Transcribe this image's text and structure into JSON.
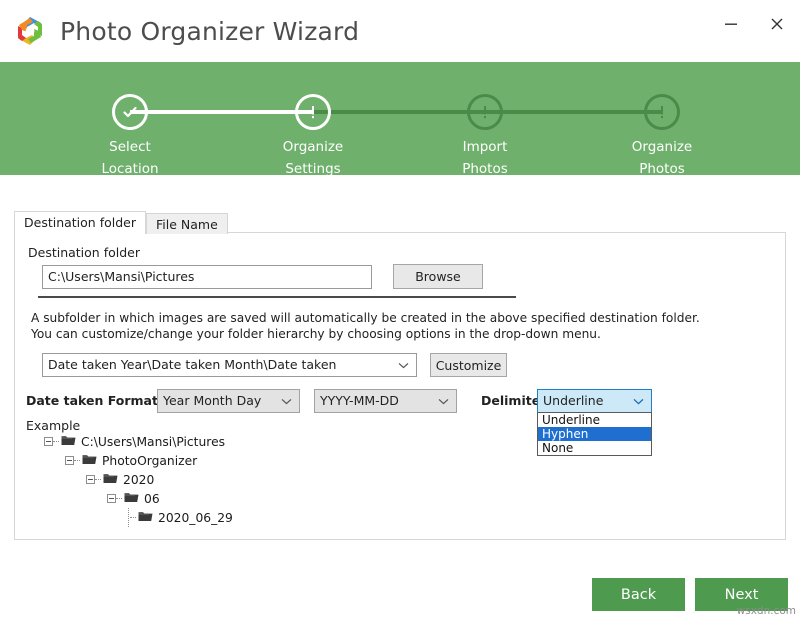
{
  "window": {
    "title": "Photo Organizer Wizard",
    "logo_icon": "hexagon-pinwheel-logo",
    "minimize_label": "Minimize",
    "close_label": "Close"
  },
  "stepper": {
    "accent_green": "#6fb16c",
    "inactive_green": "#4c8a4a",
    "steps": [
      {
        "line1": "Select",
        "line2": "Location",
        "state": "completed",
        "icon": "check-icon"
      },
      {
        "line1": "Organize",
        "line2": "Settings",
        "state": "current",
        "icon": "exclamation-icon"
      },
      {
        "line1": "Import",
        "line2": "Photos",
        "state": "pending",
        "icon": "exclamation-icon"
      },
      {
        "line1": "Organize",
        "line2": "Photos",
        "state": "pending",
        "icon": "exclamation-icon"
      }
    ]
  },
  "tabs": [
    {
      "label": "Destination folder",
      "active": true
    },
    {
      "label": "File Name",
      "active": false
    }
  ],
  "form": {
    "destination_label": "Destination folder",
    "destination_value": "C:\\Users\\Mansi\\Pictures",
    "browse_label": "Browse",
    "description_line1": "A subfolder in which images are saved will automatically be created in the above specified destination folder.",
    "description_line2": "You can customize/change your folder hierarchy by choosing options in the drop-down menu.",
    "hierarchy_value": "Date taken Year\\Date taken Month\\Date taken",
    "customize_label": "Customize",
    "date_format_label": "Date taken Format",
    "date_order_value": "Year Month Day",
    "date_pattern_value": "YYYY-MM-DD",
    "delimiter_label": "Delimiter",
    "delimiter_value": "Underline",
    "delimiter_options": [
      {
        "label": "Underline",
        "selected": false
      },
      {
        "label": "Hyphen",
        "selected": true
      },
      {
        "label": "None",
        "selected": false
      }
    ],
    "chevron_icon": "chevron-down-icon"
  },
  "example": {
    "heading": "Example",
    "tree": [
      {
        "name": "C:\\Users\\Mansi\\Pictures",
        "depth": 0,
        "expander": "minus",
        "icon": "folder-icon"
      },
      {
        "name": "PhotoOrganizer",
        "depth": 1,
        "expander": "minus",
        "icon": "folder-icon"
      },
      {
        "name": "2020",
        "depth": 2,
        "expander": "minus",
        "icon": "folder-icon"
      },
      {
        "name": "06",
        "depth": 3,
        "expander": "minus",
        "icon": "folder-icon"
      },
      {
        "name": "2020_06_29",
        "depth": 4,
        "expander": "none",
        "icon": "folder-icon"
      }
    ]
  },
  "footer": {
    "back_label": "Back",
    "next_label": "Next",
    "button_color": "#4e9a4e",
    "watermark": "wsxdn.com"
  }
}
